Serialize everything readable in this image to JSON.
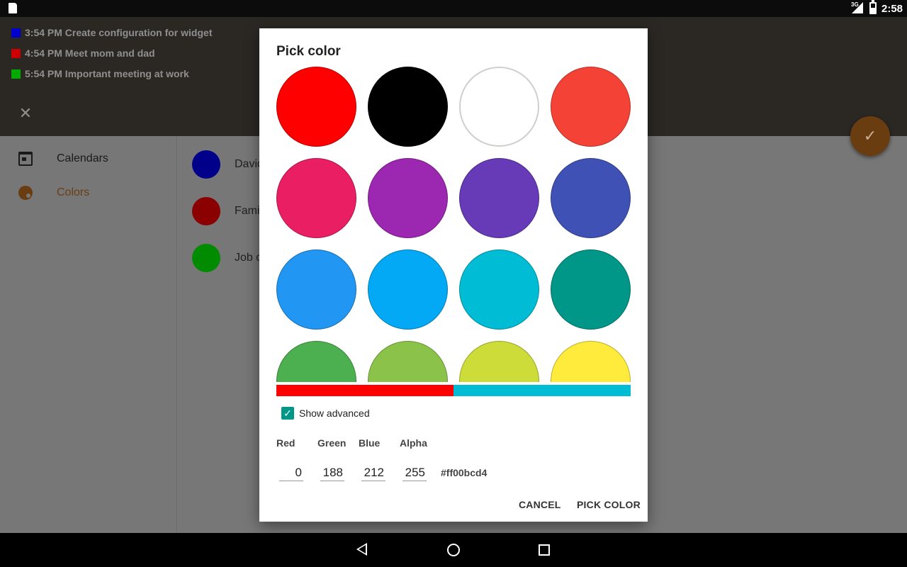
{
  "status_bar": {
    "network": "3G",
    "time": "2:58"
  },
  "events": [
    {
      "text": "3:54 PM Create configuration for widget",
      "color": "#0000cc"
    },
    {
      "text": "4:54 PM Meet mom and dad",
      "color": "#cc0000"
    },
    {
      "text": "5:54 PM Important meeting at work",
      "color": "#00aa00"
    }
  ],
  "sidebar": {
    "items": [
      {
        "label": "Calendars",
        "icon": "calendar-icon",
        "color": "#1a1a1a"
      },
      {
        "label": "Colors",
        "icon": "palette-icon",
        "color": "#6a3d10"
      }
    ]
  },
  "calendars": [
    {
      "name": "David",
      "color": "#00008b"
    },
    {
      "name": "Family",
      "color": "#8b0000"
    },
    {
      "name": "Job c",
      "color": "#008b00"
    }
  ],
  "dialog": {
    "title": "Pick color",
    "colors": [
      "#ff0000",
      "#000000",
      "#ffffff",
      "#f44336",
      "#e91e63",
      "#9c27b0",
      "#673ab7",
      "#3f51b5",
      "#2196f3",
      "#03a9f4",
      "#00bcd4",
      "#009688",
      "#4caf50",
      "#8bc34a",
      "#cddc39",
      "#ffeb3b"
    ],
    "strip": {
      "old_color": "#ff0000",
      "new_color": "#00bcd4"
    },
    "show_advanced_label": "Show advanced",
    "show_advanced_checked": true,
    "channels": {
      "red": {
        "label": "Red",
        "value": "0"
      },
      "green": {
        "label": "Green",
        "value": "188"
      },
      "blue": {
        "label": "Blue",
        "value": "212"
      },
      "alpha": {
        "label": "Alpha",
        "value": "255"
      }
    },
    "hex": "#ff00bcd4",
    "cancel_label": "CANCEL",
    "pick_label": "PICK COLOR"
  }
}
